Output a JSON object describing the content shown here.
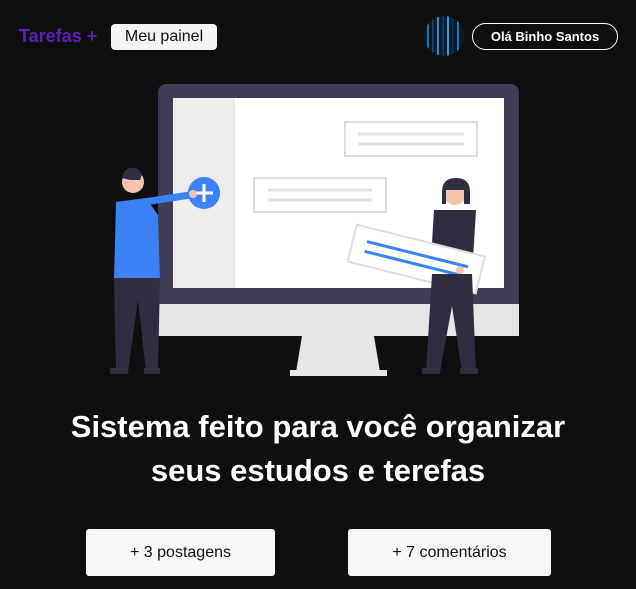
{
  "header": {
    "brand": "Tarefas +",
    "panel_button": "Meu painel",
    "user_button": "Olá Binho Santos",
    "avatar_icon": "user-avatar-icon"
  },
  "hero": {
    "headline_line1": "Sistema feito para você organizar",
    "headline_line2": "seus estudos e terefas"
  },
  "stats": {
    "posts": "+ 3 postagens",
    "comments": "+ 7 comentários"
  },
  "colors": {
    "background": "#0f0f0f",
    "brand": "#5b21b6",
    "accent": "#3b82f6"
  }
}
